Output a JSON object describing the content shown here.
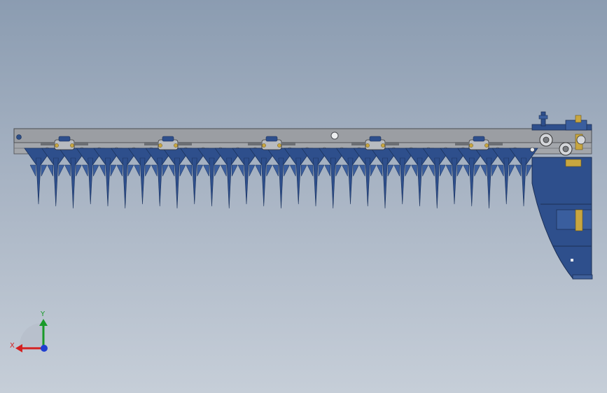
{
  "viewport": {
    "background_top": "#8b9cb1",
    "background_bottom": "#c6ced8"
  },
  "model": {
    "rail_color": "#9b9ea3",
    "blade_color": "#2e4f8c",
    "blade_dark": "#1c345f",
    "brass_color": "#c8a640",
    "finger_count": 29,
    "clamp_count": 5
  },
  "triad": {
    "x_label": "X",
    "y_label": "Y",
    "x_color": "#d42020",
    "y_color": "#1a9a2a",
    "z_color": "#1f3fd0"
  }
}
